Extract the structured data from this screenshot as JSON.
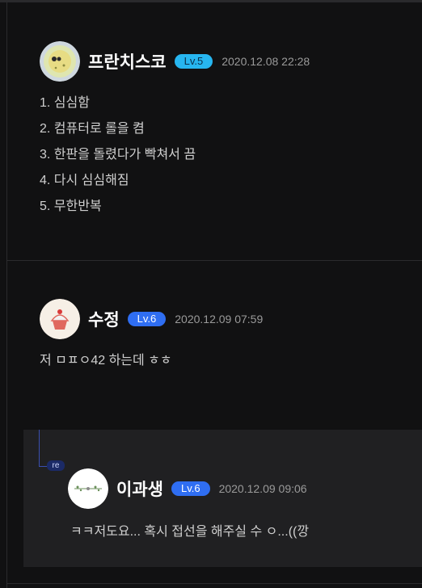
{
  "comments": [
    {
      "nickname": "프란치스코",
      "level": "Lv.5",
      "date": "2020.12.08 22:28",
      "lines": [
        "1. 심심함",
        "2. 컴퓨터로 롤을 켬",
        "3. 한판을 돌렸다가 빡쳐서 끔",
        "4. 다시 심심해짐",
        "5. 무한반복"
      ]
    },
    {
      "nickname": "수정",
      "level": "Lv.6",
      "date": "2020.12.09 07:59",
      "text": "저 ㅁㅍㅇ42 하는데 ㅎㅎ"
    }
  ],
  "reply": {
    "tag": "re",
    "nickname": "이과생",
    "level": "Lv.6",
    "date": "2020.12.09 09:06",
    "text": "ㅋㅋ저도요... 혹시 접선을 해주실 수 ㅇ...((깡"
  }
}
